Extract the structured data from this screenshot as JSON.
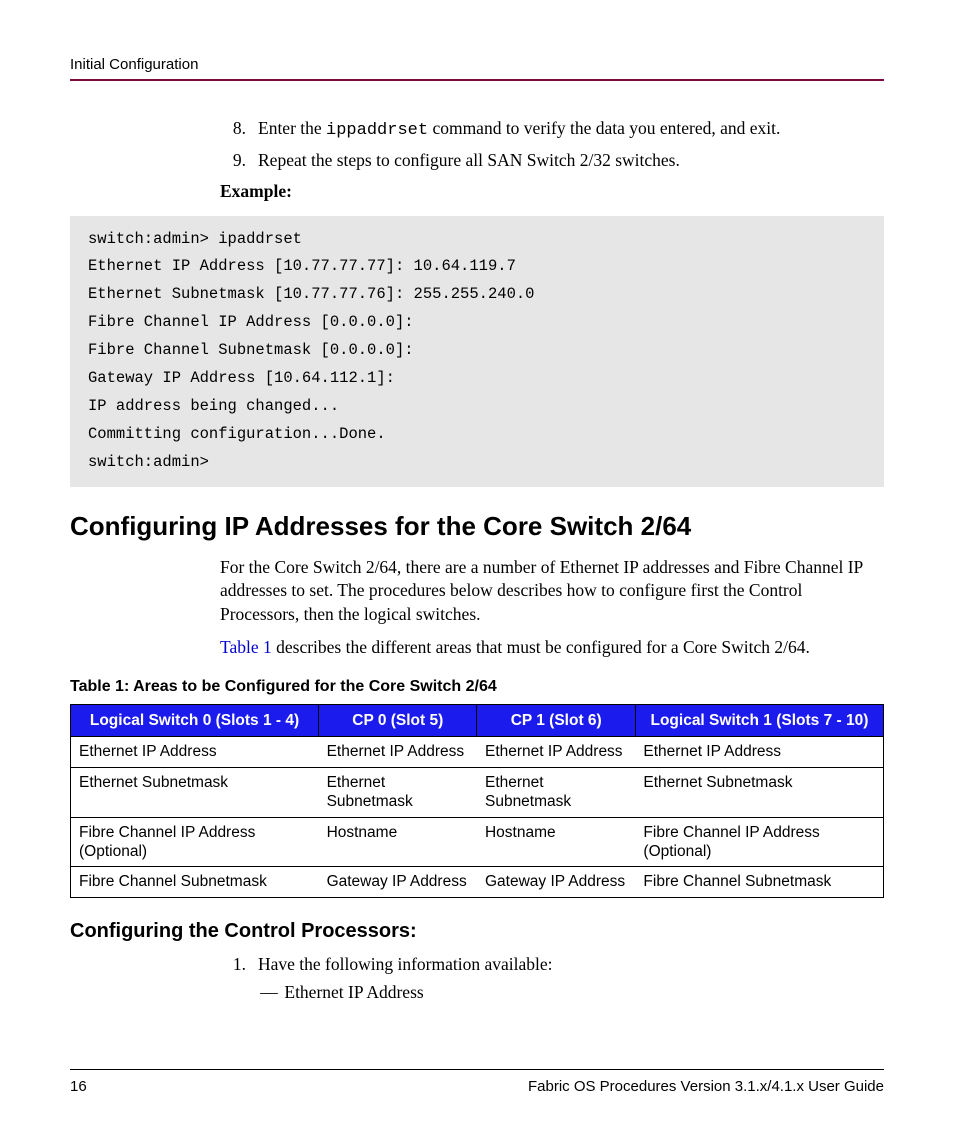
{
  "header": {
    "sectionTitle": "Initial Configuration"
  },
  "steps": [
    {
      "num": "8.",
      "pre": "Enter the ",
      "code": "ippaddrset",
      "post": " command to verify the data you entered, and exit."
    },
    {
      "num": "9.",
      "pre": "Repeat the steps to configure all SAN Switch 2/32 switches.",
      "code": "",
      "post": ""
    }
  ],
  "exampleLabel": "Example:",
  "code": "switch:admin> ipaddrset\nEthernet IP Address [10.77.77.77]: 10.64.119.7\nEthernet Subnetmask [10.77.77.76]: 255.255.240.0\nFibre Channel IP Address [0.0.0.0]:\nFibre Channel Subnetmask [0.0.0.0]:\nGateway IP Address [10.64.112.1]:\nIP address being changed...\nCommitting configuration...Done.\nswitch:admin>",
  "h2": "Configuring IP Addresses for the Core Switch 2/64",
  "para1": "For the Core Switch 2/64, there are a number of Ethernet IP addresses and Fibre Channel IP addresses to set. The procedures below describes how to configure first the Control Processors, then the logical switches.",
  "para2link": "Table 1",
  "para2rest": " describes the different areas that must be configured for a Core Switch 2/64.",
  "tableCaption": "Table 1:  Areas to be Configured for the Core Switch 2/64",
  "table": {
    "headers": [
      "Logical Switch 0 (Slots 1 - 4)",
      "CP 0 (Slot 5)",
      "CP 1 (Slot 6)",
      "Logical Switch 1 (Slots 7 - 10)"
    ],
    "rows": [
      [
        "Ethernet IP Address",
        "Ethernet IP Address",
        "Ethernet IP Address",
        "Ethernet IP Address"
      ],
      [
        "Ethernet Subnetmask",
        "Ethernet Subnetmask",
        "Ethernet Subnetmask",
        "Ethernet Subnetmask"
      ],
      [
        "Fibre Channel IP Address (Optional)",
        "Hostname",
        "Hostname",
        "Fibre Channel IP Address (Optional)"
      ],
      [
        "Fibre Channel Subnetmask",
        "Gateway IP Address",
        "Gateway IP Address",
        "Fibre Channel Subnetmask"
      ]
    ]
  },
  "h3": "Configuring the Control Processors:",
  "step1": {
    "num": "1.",
    "text": "Have the following information available:"
  },
  "subitem": "Ethernet IP Address",
  "footer": {
    "pageNum": "16",
    "docTitle": "Fabric OS Procedures Version 3.1.x/4.1.x User Guide"
  }
}
